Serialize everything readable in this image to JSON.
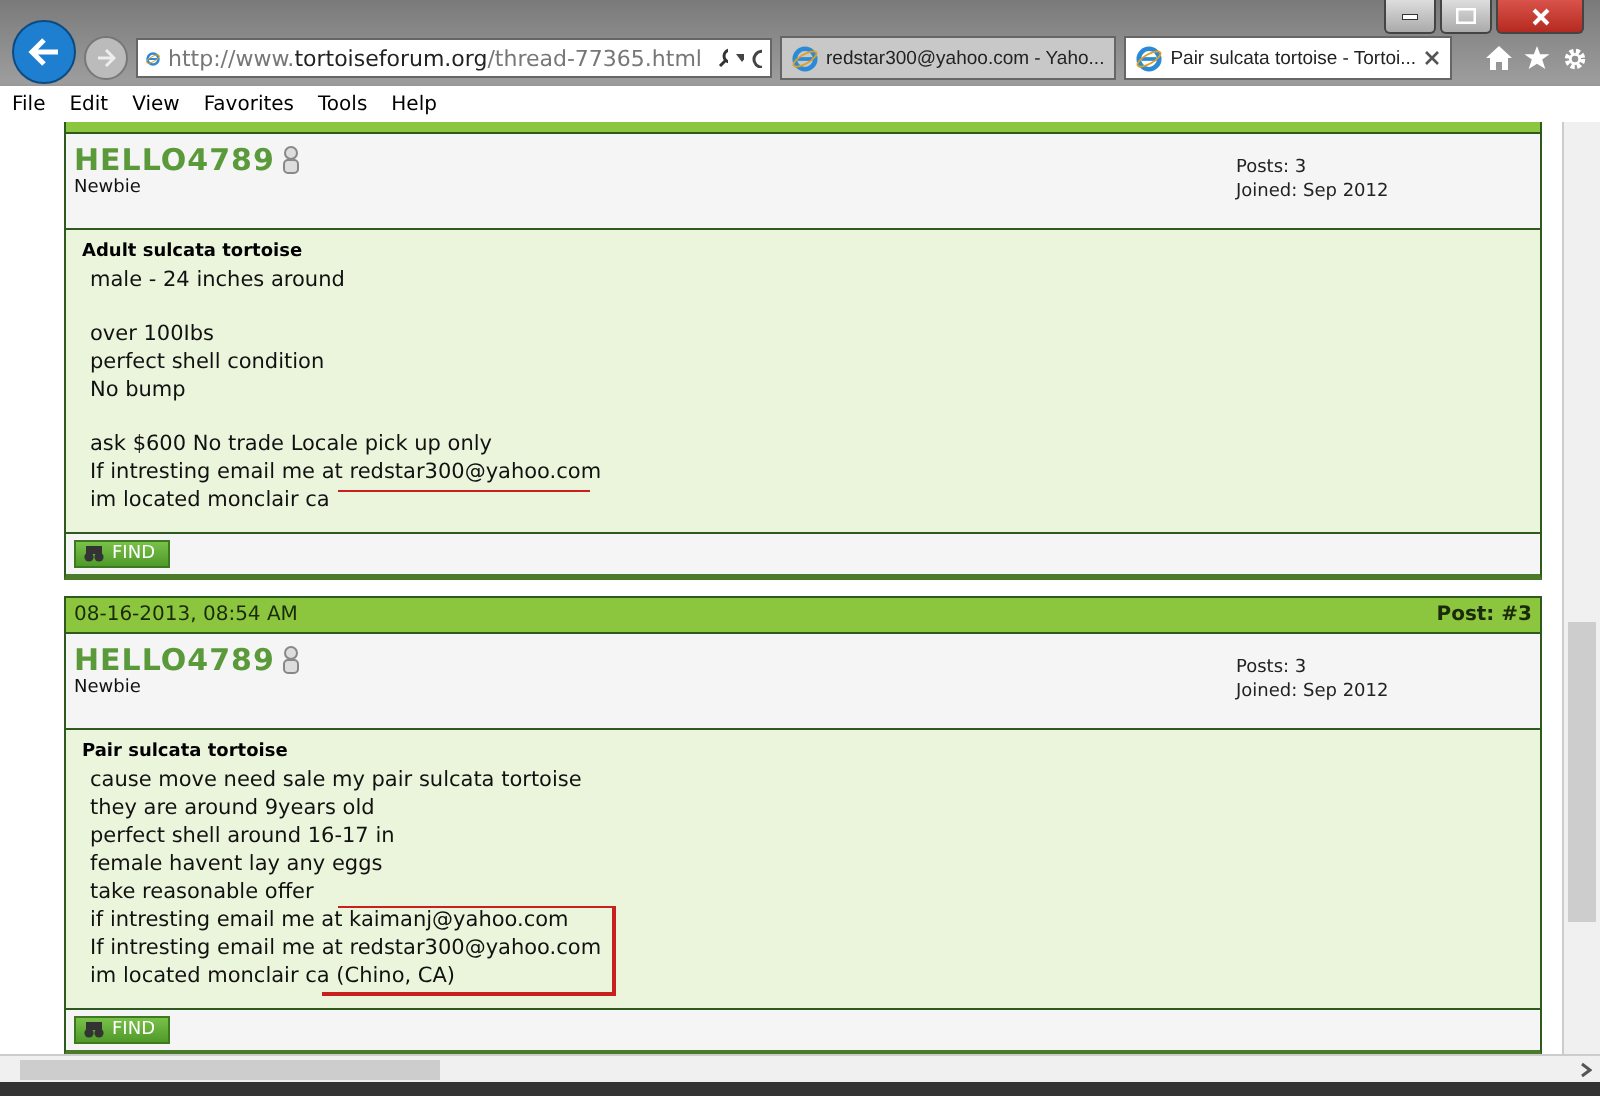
{
  "browser": {
    "address": {
      "prefix": "http://www.",
      "domain": "tortoiseforum.org",
      "suffix": "/thread-77365.html"
    },
    "tabs": [
      {
        "title": "redstar300@yahoo.com - Yaho...",
        "selected": false
      },
      {
        "title": "Pair sulcata tortoise - Tortoi...",
        "selected": true
      }
    ],
    "menu": [
      "File",
      "Edit",
      "View",
      "Favorites",
      "Tools",
      "Help"
    ]
  },
  "posts": [
    {
      "user": "HELLO4789",
      "rank": "Newbie",
      "posts": "Posts: 3",
      "joined": "Joined: Sep 2012",
      "title": "Adult sulcata tortoise",
      "underlined": true,
      "boxed": false,
      "paragraphs": [
        [
          "male - 24 inches around"
        ],
        [
          "over 100Ibs",
          "perfect shell condition",
          "No bump"
        ],
        [
          "ask $600 No trade Locale pick up only",
          "If intresting email me at redstar300@yahoo.com",
          "im located monclair ca"
        ]
      ],
      "button": "FIND"
    },
    {
      "header": {
        "date": "08-16-2013, 08:54 AM",
        "number": "Post: #3"
      },
      "user": "HELLO4789",
      "rank": "Newbie",
      "posts": "Posts: 3",
      "joined": "Joined: Sep 2012",
      "title": "Pair sulcata tortoise",
      "underlined": false,
      "boxed": true,
      "paragraphs": [
        [
          "cause move need sale my pair sulcata tortoise",
          "they are around 9years old",
          "perfect shell around 16-17 in",
          "female havent lay any eggs",
          "take reasonable offer",
          "if intresting email me at kaimanj@yahoo.com",
          "If intresting email me at redstar300@yahoo.com",
          "im located monclair ca (Chino, CA)"
        ]
      ],
      "button": "FIND"
    }
  ]
}
